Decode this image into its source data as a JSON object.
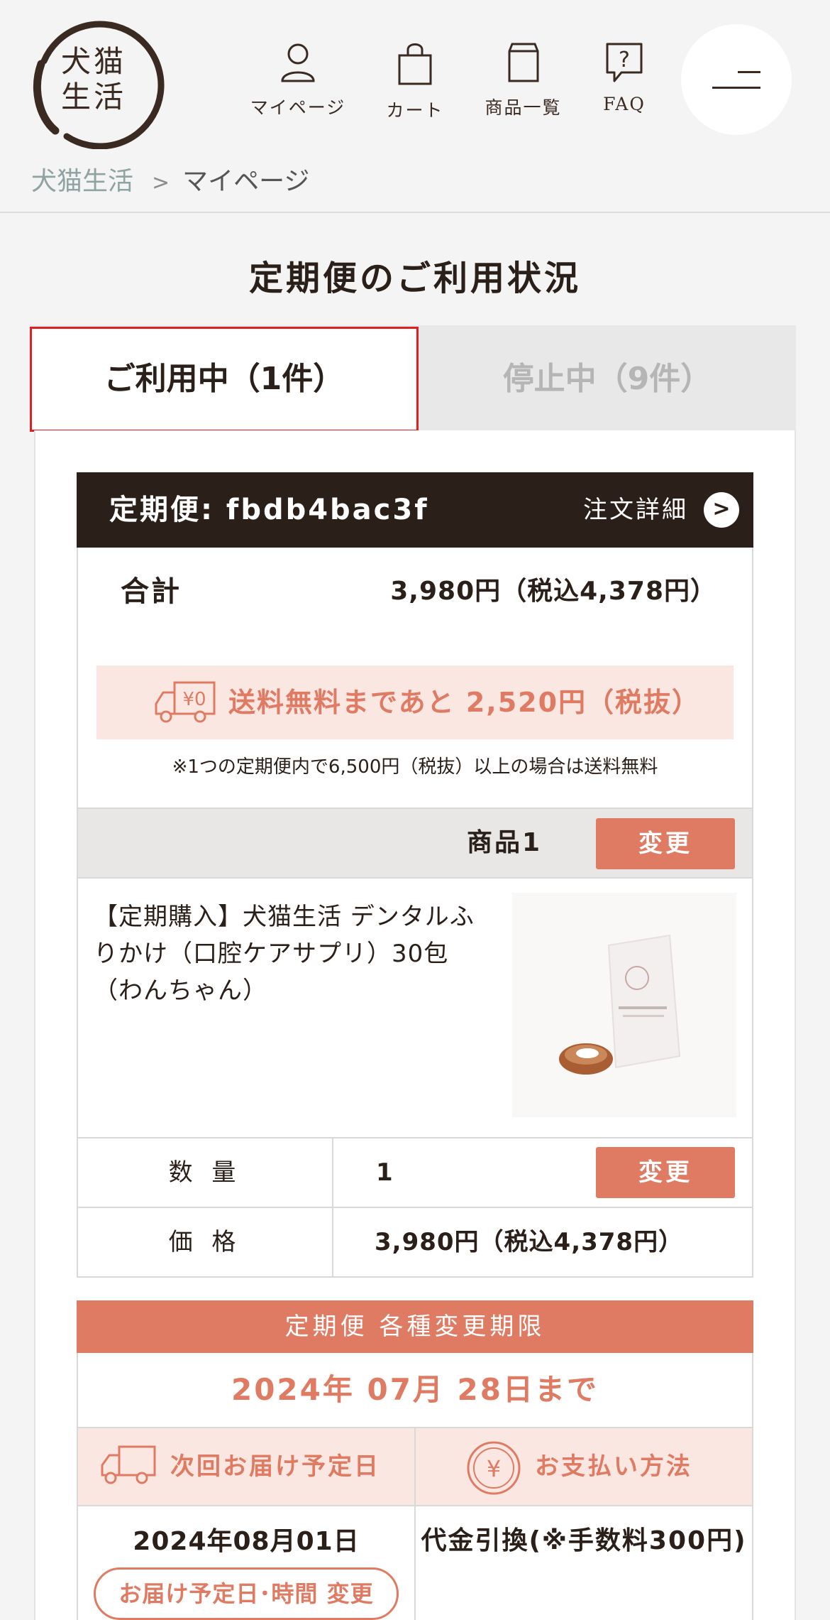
{
  "brand": {
    "logo_line1": "犬猫",
    "logo_line2": "生活"
  },
  "nav": {
    "mypage": "マイページ",
    "cart": "カート",
    "products": "商品一覧",
    "faq": "FAQ"
  },
  "breadcrumb": {
    "home": "犬猫生活",
    "separator": ">",
    "current": "マイページ"
  },
  "page_title": "定期便のご利用状況",
  "tabs": {
    "active": "ご利用中（1件）",
    "inactive": "停止中（9件）"
  },
  "subscription": {
    "id_label": "定期便: fbdb4bac3f",
    "detail_link": "注文詳細",
    "total_label": "合計",
    "total_value": "3,980円（税込4,378円）",
    "free_shipping": "送料無料まであと 2,520円（税抜）",
    "free_shipping_icon_text": "¥0",
    "shipping_note": "※1つの定期便内で6,500円（税抜）以上の場合は送料無料",
    "product_heading": "商品1",
    "change_label": "変更",
    "product_name": "【定期購入】犬猫生活 デンタルふりかけ（口腔ケアサプリ）30包（わんちゃん）",
    "qty_label": "数 量",
    "qty_value": "1",
    "price_label": "価 格",
    "price_value": "3,980円（税込4,378円）",
    "deadline_heading": "定期便 各種変更期限",
    "deadline_date": "2024年 07月 28日まで",
    "next_delivery_label": "次回お届け予定日",
    "payment_label": "お支払い方法",
    "next_delivery_date": "2024年08月01日",
    "delivery_change_button": "お届け予定日･時間 変更",
    "payment_method": "代金引換(※手数料300円)"
  },
  "colors": {
    "accent": "#e07b63",
    "dark": "#2a1f19",
    "pink_bg": "#fbe7e2",
    "active_tab_border": "#e02020"
  }
}
